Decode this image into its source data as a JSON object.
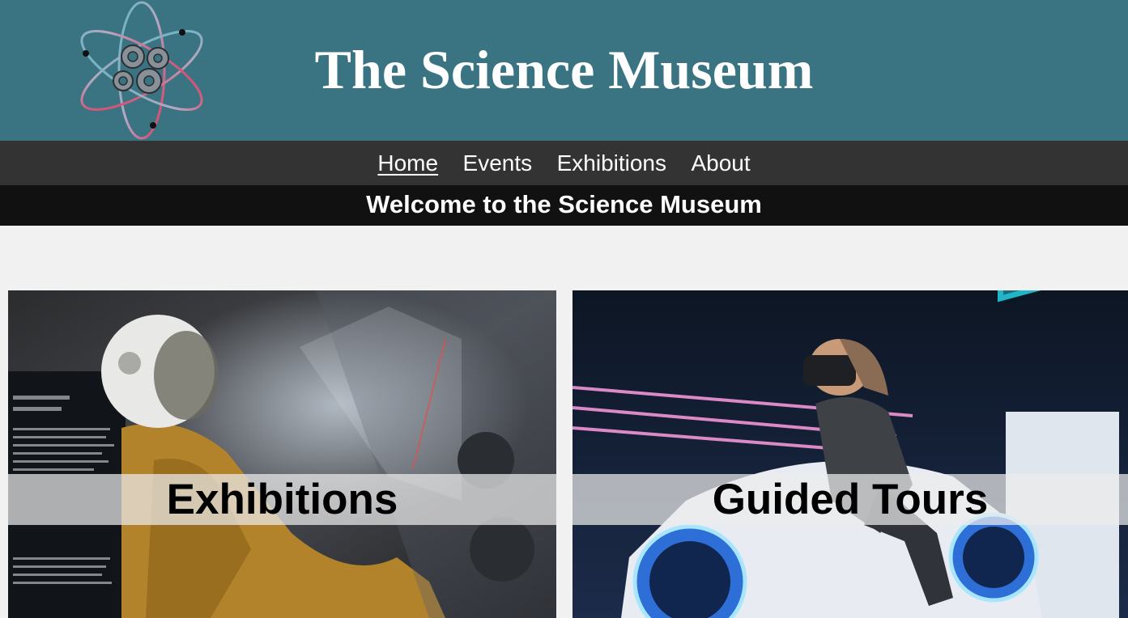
{
  "site": {
    "title": "The Science Museum"
  },
  "nav": {
    "items": [
      {
        "label": "Home",
        "active": true
      },
      {
        "label": "Events",
        "active": false
      },
      {
        "label": "Exhibitions",
        "active": false
      },
      {
        "label": "About",
        "active": false
      }
    ]
  },
  "banner": {
    "welcome": "Welcome to the Science Museum"
  },
  "cards": [
    {
      "label": "Exhibitions",
      "image": "astronaut-spacesuit-exhibit-photo"
    },
    {
      "label": "Guided Tours",
      "image": "child-vr-motorbike-ride-photo"
    }
  ],
  "colors": {
    "header_bg": "#3a7482",
    "nav_bg": "#333333",
    "banner_bg": "#111111",
    "page_bg": "#f1f1f1",
    "logo_teal": "#5fb8c4",
    "logo_pink": "#e0335a"
  },
  "icons": {
    "logo": "atom-gears-logo-icon"
  }
}
